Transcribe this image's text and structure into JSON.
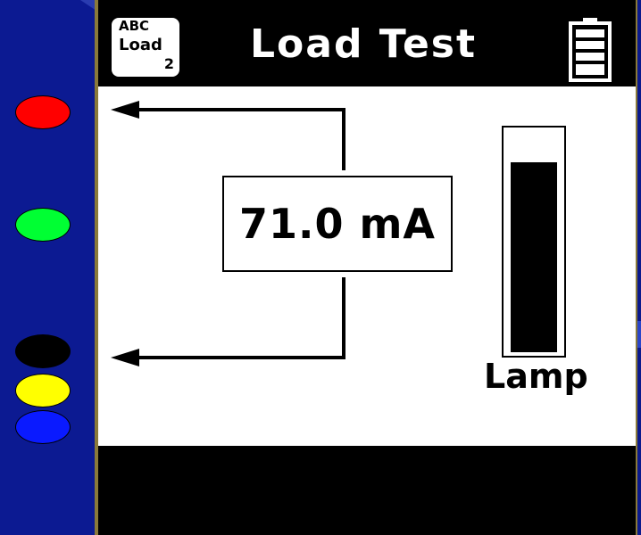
{
  "header": {
    "mode_icon": {
      "line1": "ABC",
      "line2": "Load",
      "line3": "2"
    },
    "title": "Load Test",
    "battery_icon": "battery-full-icon"
  },
  "reading": {
    "value": "71.0 mA"
  },
  "lamp": {
    "label": "Lamp",
    "level": 0.86
  },
  "indicators": {
    "colors": [
      "#ff0000",
      "#00ff33",
      "#000000",
      "#ffff00",
      "#0a1aff"
    ]
  }
}
